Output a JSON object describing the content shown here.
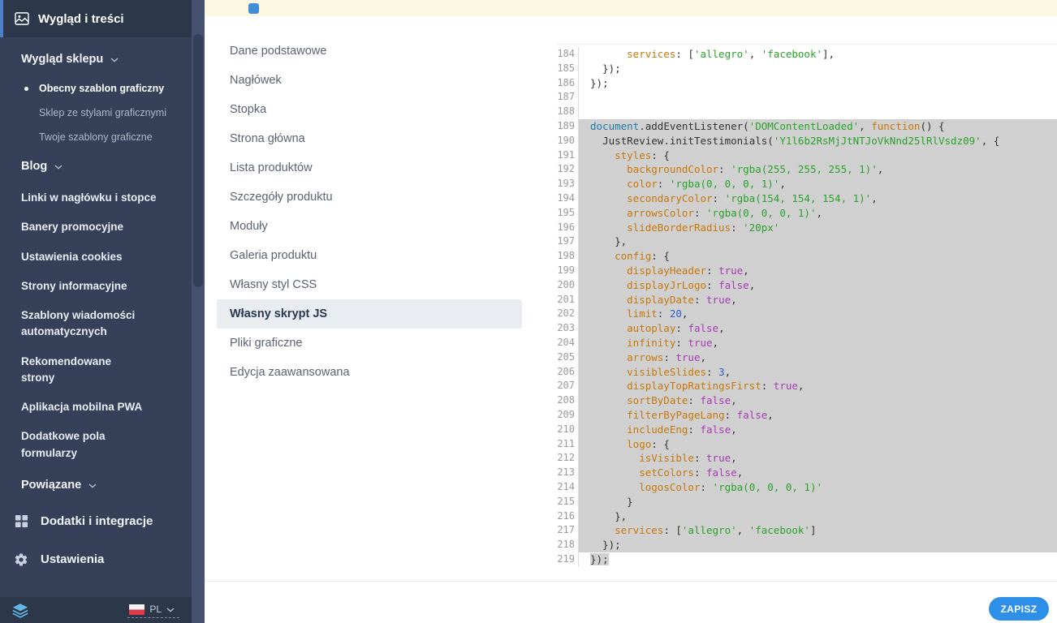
{
  "colors": {
    "accent": "#2e8fe8",
    "sidebar_bg": "#364159",
    "banner_bg": "#fcf7e1"
  },
  "sidebar": {
    "header": {
      "label": "Wygląd i treści"
    },
    "items": [
      {
        "label": "Wygląd sklepu",
        "type": "group",
        "chevron": true
      },
      {
        "label": "Obecny szablon graficzny",
        "type": "sub",
        "active": true
      },
      {
        "label": "Sklep ze stylami graficznymi",
        "type": "sub"
      },
      {
        "label": "Twoje szablony graficzne",
        "type": "sub"
      },
      {
        "label": "Blog",
        "type": "group",
        "chevron": true
      },
      {
        "label": "Linki w nagłówku i stopce",
        "type": "item"
      },
      {
        "label": "Banery promocyjne",
        "type": "item"
      },
      {
        "label": "Ustawienia cookies",
        "type": "item"
      },
      {
        "label": "Strony informacyjne",
        "type": "item"
      },
      {
        "label": "Szablony wiadomości\nautomatycznych",
        "type": "item"
      },
      {
        "label": "Rekomendowane\nstrony",
        "type": "item"
      },
      {
        "label": "Aplikacja mobilna PWA",
        "type": "item"
      },
      {
        "label": "Dodatkowe pola\nformularzy",
        "type": "item"
      },
      {
        "label": "Powiązane",
        "type": "group",
        "chevron": true
      },
      {
        "label": "Dodatki i integracje",
        "type": "section",
        "icon": "modules-grid-icon"
      },
      {
        "label": "Ustawienia",
        "type": "section",
        "icon": "gear-icon"
      }
    ],
    "footer": {
      "language": "PL"
    }
  },
  "settings_menu": {
    "items": [
      {
        "label": "Dane podstawowe"
      },
      {
        "label": "Nagłówek"
      },
      {
        "label": "Stopka"
      },
      {
        "label": "Strona główna"
      },
      {
        "label": "Lista produktów"
      },
      {
        "label": "Szczegóły produktu"
      },
      {
        "label": "Moduły"
      },
      {
        "label": "Galeria produktu"
      },
      {
        "label": "Własny styl CSS"
      },
      {
        "label": "Własny skrypt JS",
        "active": true
      },
      {
        "label": "Pliki graficzne"
      },
      {
        "label": "Edycja zaawansowana"
      }
    ]
  },
  "editor": {
    "colors": {
      "prop": "#c7770a",
      "string": "#2aa12a",
      "bool": "#a63cb3",
      "num": "#2f5bd6",
      "kw": "#c7770a",
      "var": "#2179a8",
      "method": "#333333",
      "plain": "#333333",
      "selection": "#d0d0d0",
      "gutter_text": "#9a9a9a"
    },
    "lines": [
      {
        "n": 184,
        "sel": false,
        "t": [
          [
            "pl",
            "      "
          ],
          [
            "pr",
            "services"
          ],
          [
            "pl",
            ": ["
          ],
          [
            "st",
            "'allegro'"
          ],
          [
            "pl",
            ", "
          ],
          [
            "st",
            "'facebook'"
          ],
          [
            "pl",
            "],"
          ]
        ]
      },
      {
        "n": 185,
        "sel": false,
        "t": [
          [
            "pl",
            "  });"
          ]
        ]
      },
      {
        "n": 186,
        "sel": false,
        "t": [
          [
            "pl",
            "});"
          ]
        ]
      },
      {
        "n": 187,
        "sel": false,
        "t": []
      },
      {
        "n": 188,
        "sel": false,
        "t": []
      },
      {
        "n": 189,
        "sel": true,
        "t": [
          [
            "va",
            "document"
          ],
          [
            "pl",
            "."
          ],
          [
            "me",
            "addEventListener"
          ],
          [
            "pl",
            "("
          ],
          [
            "st",
            "'DOMContentLoaded'"
          ],
          [
            "pl",
            ", "
          ],
          [
            "kw",
            "function"
          ],
          [
            "pl",
            "() {"
          ]
        ]
      },
      {
        "n": 190,
        "sel": true,
        "t": [
          [
            "pl",
            "  "
          ],
          [
            "me",
            "JustReview"
          ],
          [
            "pl",
            "."
          ],
          [
            "me",
            "initTestimonials"
          ],
          [
            "pl",
            "("
          ],
          [
            "st",
            "'Y1l6b2RsMjJtNTJoVkNnd25lRlVsdz09'"
          ],
          [
            "pl",
            ", {"
          ]
        ]
      },
      {
        "n": 191,
        "sel": true,
        "t": [
          [
            "pl",
            "    "
          ],
          [
            "pr",
            "styles"
          ],
          [
            "pl",
            ": {"
          ]
        ]
      },
      {
        "n": 192,
        "sel": true,
        "t": [
          [
            "pl",
            "      "
          ],
          [
            "pr",
            "backgroundColor"
          ],
          [
            "pl",
            ": "
          ],
          [
            "st",
            "'rgba(255, 255, 255, 1)'"
          ],
          [
            "pl",
            ","
          ]
        ]
      },
      {
        "n": 193,
        "sel": true,
        "t": [
          [
            "pl",
            "      "
          ],
          [
            "pr",
            "color"
          ],
          [
            "pl",
            ": "
          ],
          [
            "st",
            "'rgba(0, 0, 0, 1)'"
          ],
          [
            "pl",
            ","
          ]
        ]
      },
      {
        "n": 194,
        "sel": true,
        "t": [
          [
            "pl",
            "      "
          ],
          [
            "pr",
            "secondaryColor"
          ],
          [
            "pl",
            ": "
          ],
          [
            "st",
            "'rgba(154, 154, 154, 1)'"
          ],
          [
            "pl",
            ","
          ]
        ]
      },
      {
        "n": 195,
        "sel": true,
        "t": [
          [
            "pl",
            "      "
          ],
          [
            "pr",
            "arrowsColor"
          ],
          [
            "pl",
            ": "
          ],
          [
            "st",
            "'rgba(0, 0, 0, 1)'"
          ],
          [
            "pl",
            ","
          ]
        ]
      },
      {
        "n": 196,
        "sel": true,
        "t": [
          [
            "pl",
            "      "
          ],
          [
            "pr",
            "slideBorderRadius"
          ],
          [
            "pl",
            ": "
          ],
          [
            "st",
            "'20px'"
          ]
        ]
      },
      {
        "n": 197,
        "sel": true,
        "t": [
          [
            "pl",
            "    },"
          ]
        ]
      },
      {
        "n": 198,
        "sel": true,
        "t": [
          [
            "pl",
            "    "
          ],
          [
            "pr",
            "config"
          ],
          [
            "pl",
            ": {"
          ]
        ]
      },
      {
        "n": 199,
        "sel": true,
        "t": [
          [
            "pl",
            "      "
          ],
          [
            "pr",
            "displayHeader"
          ],
          [
            "pl",
            ": "
          ],
          [
            "bo",
            "true"
          ],
          [
            "pl",
            ","
          ]
        ]
      },
      {
        "n": 200,
        "sel": true,
        "t": [
          [
            "pl",
            "      "
          ],
          [
            "pr",
            "displayJrLogo"
          ],
          [
            "pl",
            ": "
          ],
          [
            "bo",
            "false"
          ],
          [
            "pl",
            ","
          ]
        ]
      },
      {
        "n": 201,
        "sel": true,
        "t": [
          [
            "pl",
            "      "
          ],
          [
            "pr",
            "displayDate"
          ],
          [
            "pl",
            ": "
          ],
          [
            "bo",
            "true"
          ],
          [
            "pl",
            ","
          ]
        ]
      },
      {
        "n": 202,
        "sel": true,
        "t": [
          [
            "pl",
            "      "
          ],
          [
            "pr",
            "limit"
          ],
          [
            "pl",
            ": "
          ],
          [
            "nu",
            "20"
          ],
          [
            "pl",
            ","
          ]
        ]
      },
      {
        "n": 203,
        "sel": true,
        "t": [
          [
            "pl",
            "      "
          ],
          [
            "pr",
            "autoplay"
          ],
          [
            "pl",
            ": "
          ],
          [
            "bo",
            "false"
          ],
          [
            "pl",
            ","
          ]
        ]
      },
      {
        "n": 204,
        "sel": true,
        "t": [
          [
            "pl",
            "      "
          ],
          [
            "pr",
            "infinity"
          ],
          [
            "pl",
            ": "
          ],
          [
            "bo",
            "true"
          ],
          [
            "pl",
            ","
          ]
        ]
      },
      {
        "n": 205,
        "sel": true,
        "t": [
          [
            "pl",
            "      "
          ],
          [
            "pr",
            "arrows"
          ],
          [
            "pl",
            ": "
          ],
          [
            "bo",
            "true"
          ],
          [
            "pl",
            ","
          ]
        ]
      },
      {
        "n": 206,
        "sel": true,
        "t": [
          [
            "pl",
            "      "
          ],
          [
            "pr",
            "visibleSlides"
          ],
          [
            "pl",
            ": "
          ],
          [
            "nu",
            "3"
          ],
          [
            "pl",
            ","
          ]
        ]
      },
      {
        "n": 207,
        "sel": true,
        "t": [
          [
            "pl",
            "      "
          ],
          [
            "pr",
            "displayTopRatingsFirst"
          ],
          [
            "pl",
            ": "
          ],
          [
            "bo",
            "true"
          ],
          [
            "pl",
            ","
          ]
        ]
      },
      {
        "n": 208,
        "sel": true,
        "t": [
          [
            "pl",
            "      "
          ],
          [
            "pr",
            "sortByDate"
          ],
          [
            "pl",
            ": "
          ],
          [
            "bo",
            "false"
          ],
          [
            "pl",
            ","
          ]
        ]
      },
      {
        "n": 209,
        "sel": true,
        "t": [
          [
            "pl",
            "      "
          ],
          [
            "pr",
            "filterByPageLang"
          ],
          [
            "pl",
            ": "
          ],
          [
            "bo",
            "false"
          ],
          [
            "pl",
            ","
          ]
        ]
      },
      {
        "n": 210,
        "sel": true,
        "t": [
          [
            "pl",
            "      "
          ],
          [
            "pr",
            "includeEng"
          ],
          [
            "pl",
            ": "
          ],
          [
            "bo",
            "false"
          ],
          [
            "pl",
            ","
          ]
        ]
      },
      {
        "n": 211,
        "sel": true,
        "t": [
          [
            "pl",
            "      "
          ],
          [
            "pr",
            "logo"
          ],
          [
            "pl",
            ": {"
          ]
        ]
      },
      {
        "n": 212,
        "sel": true,
        "t": [
          [
            "pl",
            "        "
          ],
          [
            "pr",
            "isVisible"
          ],
          [
            "pl",
            ": "
          ],
          [
            "bo",
            "true"
          ],
          [
            "pl",
            ","
          ]
        ]
      },
      {
        "n": 213,
        "sel": true,
        "t": [
          [
            "pl",
            "        "
          ],
          [
            "pr",
            "setColors"
          ],
          [
            "pl",
            ": "
          ],
          [
            "bo",
            "false"
          ],
          [
            "pl",
            ","
          ]
        ]
      },
      {
        "n": 214,
        "sel": true,
        "t": [
          [
            "pl",
            "        "
          ],
          [
            "pr",
            "logosColor"
          ],
          [
            "pl",
            ": "
          ],
          [
            "st",
            "'rgba(0, 0, 0, 1)'"
          ]
        ]
      },
      {
        "n": 215,
        "sel": true,
        "t": [
          [
            "pl",
            "      }"
          ]
        ]
      },
      {
        "n": 216,
        "sel": true,
        "t": [
          [
            "pl",
            "    },"
          ]
        ]
      },
      {
        "n": 217,
        "sel": true,
        "t": [
          [
            "pl",
            "    "
          ],
          [
            "pr",
            "services"
          ],
          [
            "pl",
            ": ["
          ],
          [
            "st",
            "'allegro'"
          ],
          [
            "pl",
            ", "
          ],
          [
            "st",
            "'facebook'"
          ],
          [
            "pl",
            "]"
          ]
        ]
      },
      {
        "n": 218,
        "sel": true,
        "t": [
          [
            "pl",
            "  });"
          ]
        ]
      },
      {
        "n": 219,
        "sel": true,
        "partial": true,
        "t": [
          [
            "pl",
            "});"
          ]
        ]
      }
    ]
  },
  "footer_bar": {
    "save_label": "ZAPISZ"
  }
}
